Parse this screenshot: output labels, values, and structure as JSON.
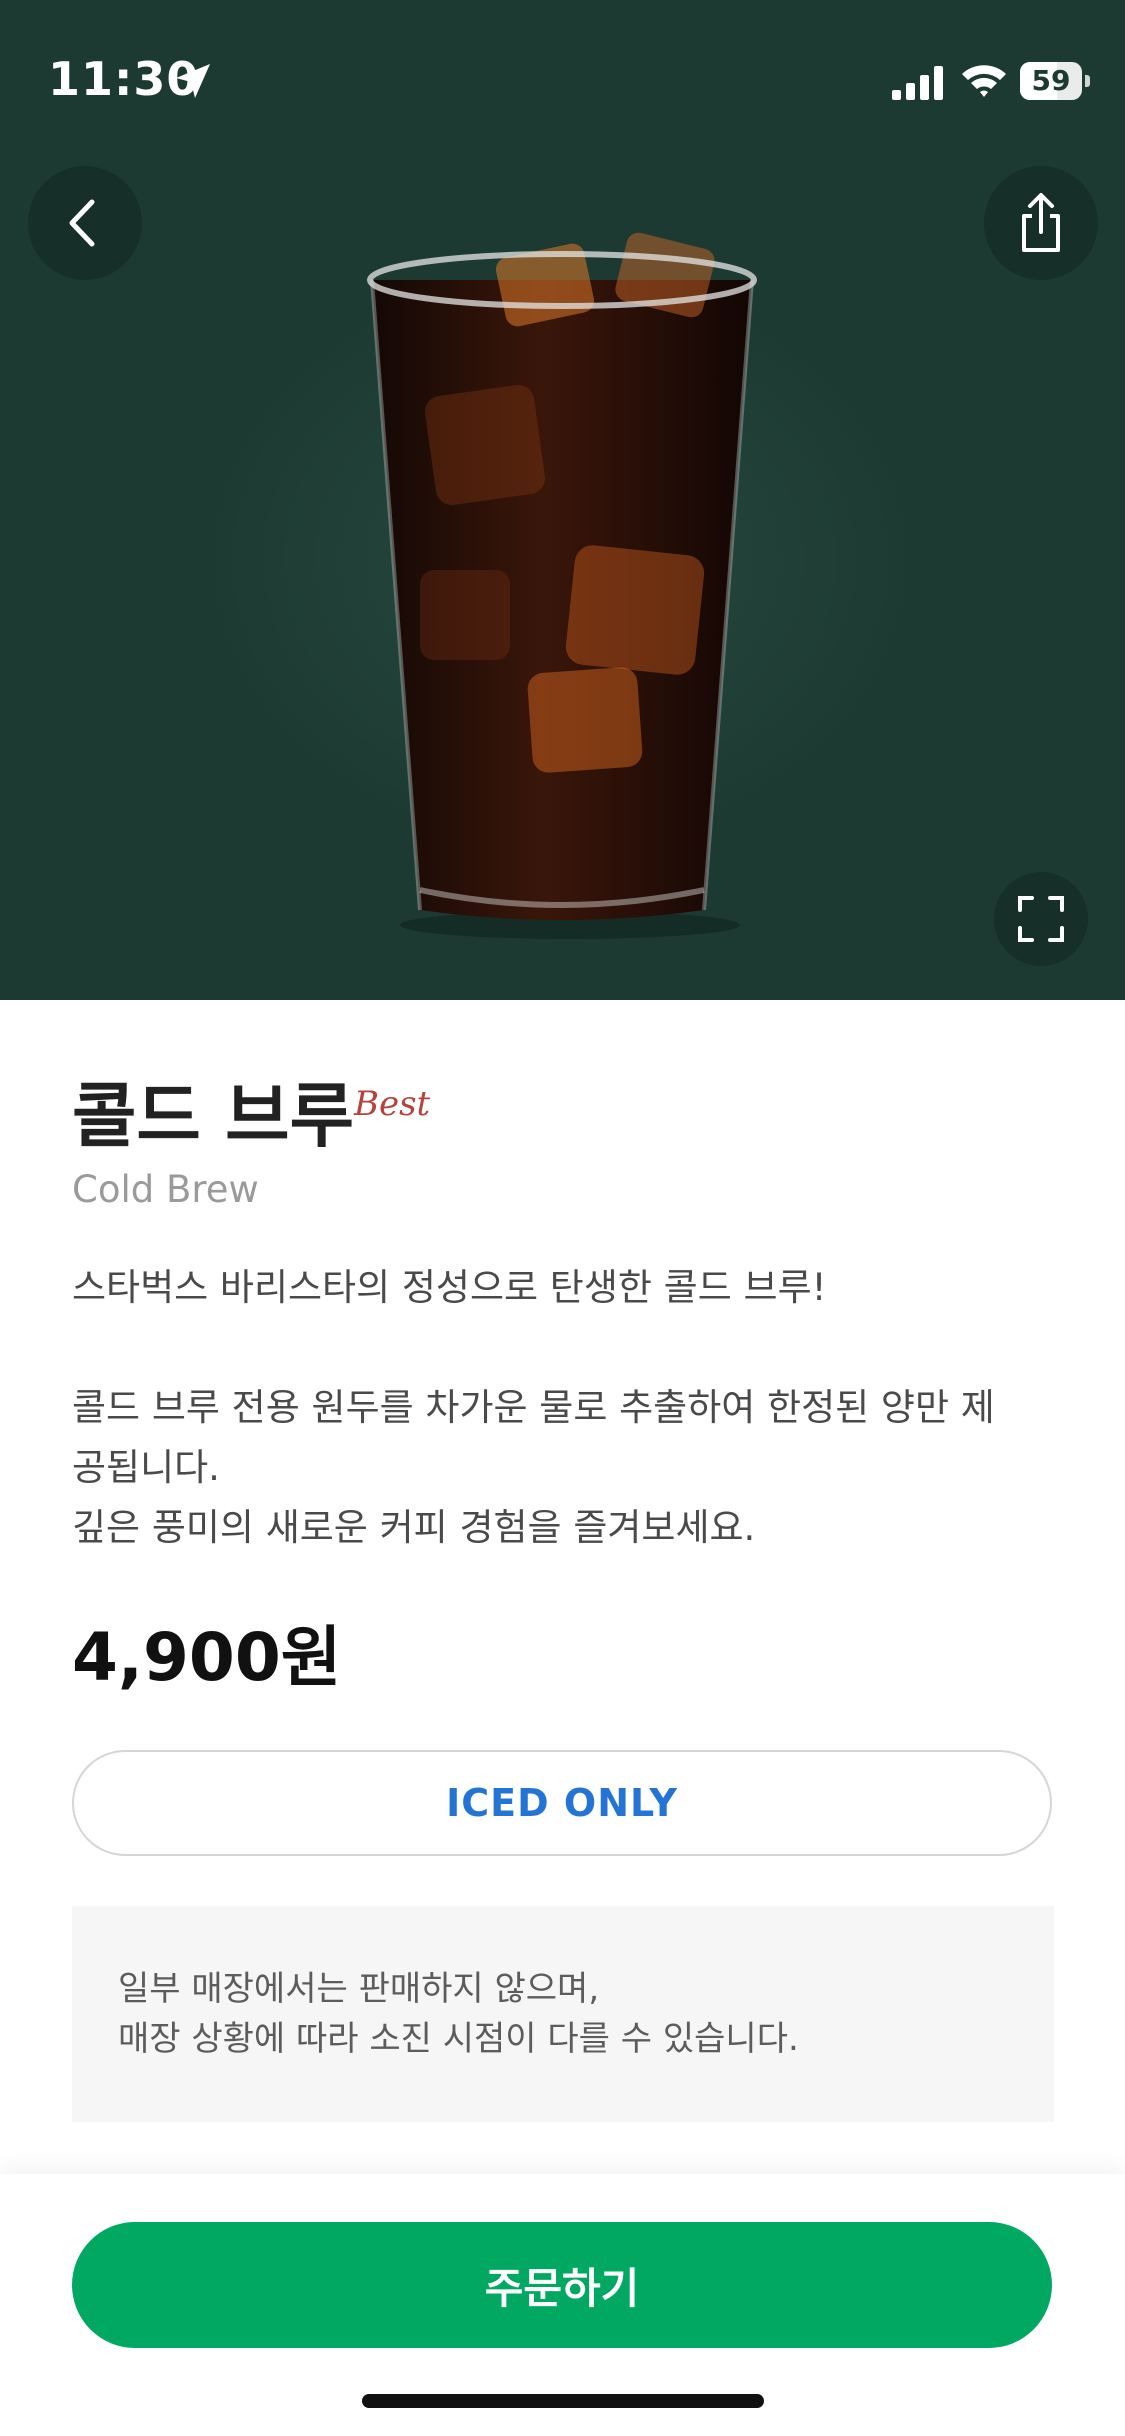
{
  "status_bar": {
    "time": "11:30",
    "battery": "59"
  },
  "product": {
    "name_ko": "콜드 브루",
    "badge": "Best",
    "name_en": "Cold Brew",
    "description": [
      "스타벅스 바리스타의 정성으로 탄생한 콜드 브루!",
      "콜드 브루 전용 원두를 차가운 물로 추출하여 한정된 양만 제",
      "공됩니다.",
      "깊은 풍미의 새로운 커피 경험을 즐겨보세요."
    ],
    "price": "4,900원",
    "temperature_option": "ICED ONLY",
    "notice": [
      "일부 매장에서는 판매하지 않으며,",
      "매장 상황에 따라 소진 시점이 다를 수 있습니다."
    ]
  },
  "actions": {
    "order_label": "주문하기"
  },
  "icons": {
    "back": "chevron-left-icon",
    "share": "share-icon",
    "expand": "expand-icon",
    "location": "location-arrow-icon",
    "signal": "cellular-signal-icon",
    "wifi": "wifi-icon",
    "battery": "battery-icon"
  },
  "colors": {
    "hero_bg": "#1d3a32",
    "accent_green": "#00a862",
    "best_badge": "#b5423c",
    "iced_label": "#2474d6"
  }
}
